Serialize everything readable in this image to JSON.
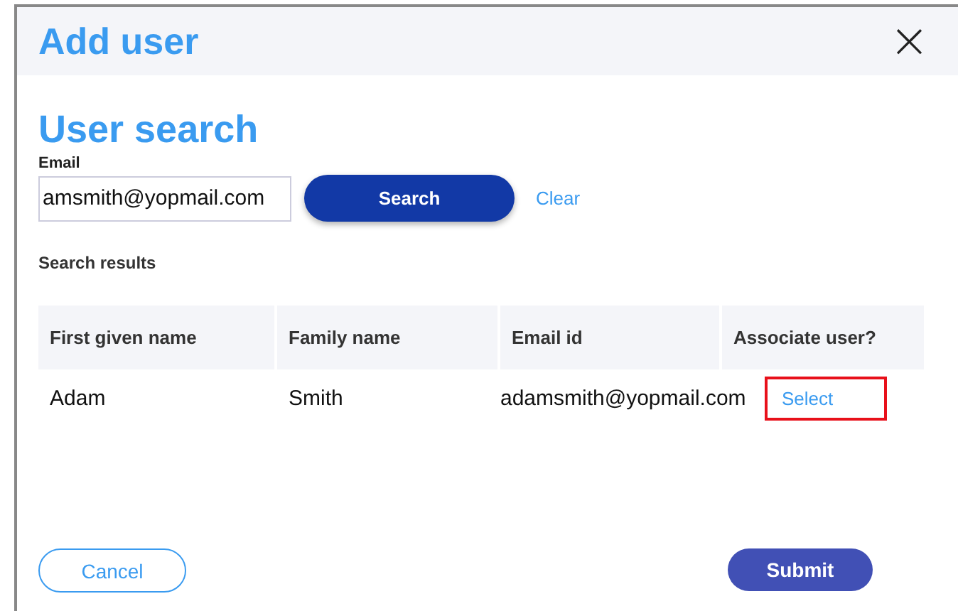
{
  "dialog": {
    "title": "Add user",
    "close": "×"
  },
  "search": {
    "heading": "User search",
    "email_label": "Email",
    "email_value": "amsmith@yopmail.com",
    "search_button": "Search",
    "clear_link": "Clear"
  },
  "results": {
    "label": "Search results",
    "columns": [
      "First given name",
      "Family name",
      "Email id",
      "Associate user?"
    ],
    "rows": [
      {
        "first_name": "Adam",
        "family_name": "Smith",
        "email": "adamsmith@yopmail.com",
        "action": "Select",
        "highlighted": true
      }
    ]
  },
  "footer": {
    "cancel": "Cancel",
    "submit": "Submit"
  }
}
